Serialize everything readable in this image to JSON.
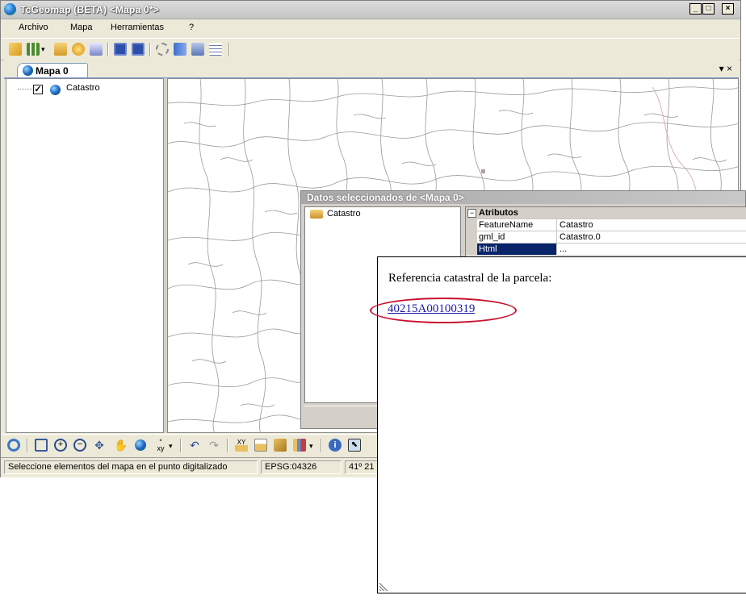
{
  "window": {
    "title": "TcGeomap (BETA) <Mapa 0*>",
    "controls": [
      "_",
      "□",
      "×"
    ]
  },
  "menu": [
    "Archivo",
    "Mapa",
    "Herramientas",
    "?"
  ],
  "tab": {
    "label": "Mapa 0",
    "controls": "▾ ×"
  },
  "tree": {
    "layer": "Catastro",
    "checked": "✓"
  },
  "status": {
    "message": "Seleccione elementos del mapa en el punto digitalizado",
    "crs": "EPSG:04326",
    "coords": "41º 21"
  },
  "datos_dialog": {
    "title": "Datos seleccionados de <Mapa 0>",
    "tree_item": "Catastro",
    "category": "Atributos",
    "rows": [
      {
        "name": "FeatureName",
        "value": "Catastro"
      },
      {
        "name": "gml_id",
        "value": "Catastro.0"
      },
      {
        "name": "Html",
        "value": "..."
      }
    ]
  },
  "html_popup": {
    "text": "Referencia catastral de la parcela:",
    "link": "40215A00100319"
  },
  "colors": {
    "highlight": "#0a246a",
    "annotation": "#c8102e",
    "link": "#1a1aa8"
  },
  "icons": {
    "toolbar_top": [
      "new-layer-icon",
      "grid-icon",
      "open-folder-icon",
      "add-icon",
      "layer-add-icon",
      "save-icon",
      "save-as-icon",
      "settings-icon",
      "network-icon",
      "layers-icon",
      "list-icon"
    ],
    "toolbar_bottom": [
      "refresh-icon",
      "zoom-box-icon",
      "zoom-in-icon",
      "zoom-out-icon",
      "pan-arrows-icon",
      "pan-hand-icon",
      "globe-icon",
      "xy-coord-icon",
      "undo-icon",
      "redo-icon",
      "xy-table-icon",
      "measure-icon",
      "edit-icon",
      "chart-icon",
      "info-icon",
      "select-icon"
    ]
  }
}
